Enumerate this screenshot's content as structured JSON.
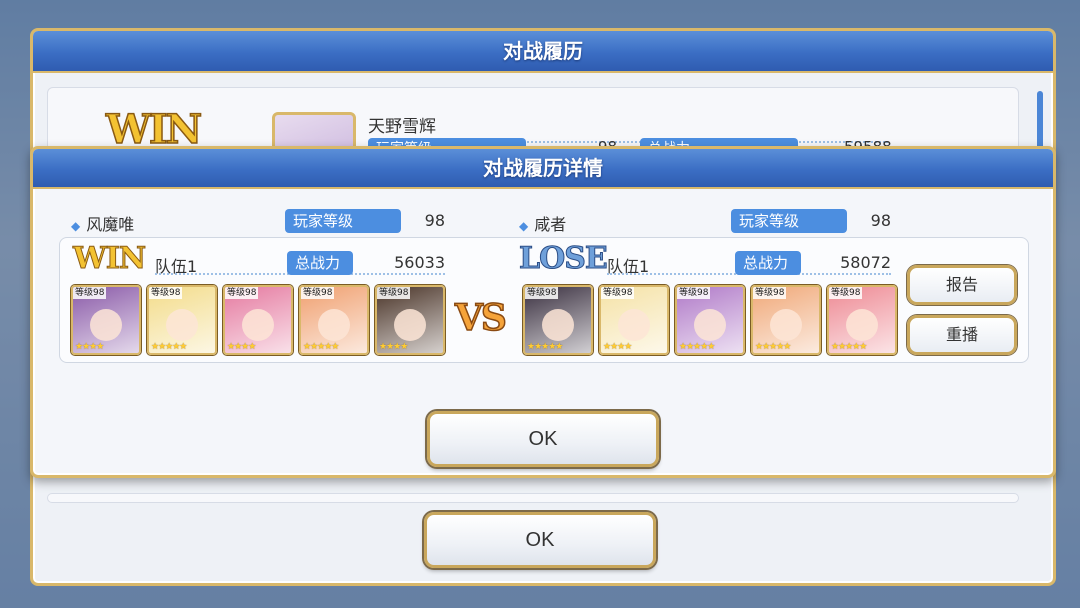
{
  "back_dialog": {
    "title": "对战履历",
    "result": "WIN",
    "player_name": "天野雪辉",
    "level_label": "玩家等级",
    "level_value": "98",
    "power_label": "总战力",
    "power_value": "59588",
    "ok_label": "OK"
  },
  "detail_dialog": {
    "title": "对战履历详情",
    "left": {
      "player_name": "风魔唯",
      "level_label": "玩家等级",
      "level_value": "98",
      "result": "WIN",
      "team_label": "队伍1",
      "power_label": "总战力",
      "power_value": "56033",
      "units": [
        {
          "level": "等级98",
          "stars": "★★★★",
          "color": "#8a5aa8"
        },
        {
          "level": "等级98",
          "stars": "★★★★★",
          "color": "#f3dc8a"
        },
        {
          "level": "等级98",
          "stars": "★★★★",
          "color": "#e57aa0"
        },
        {
          "level": "等级98",
          "stars": "★★★★★",
          "color": "#f0a070"
        },
        {
          "level": "等级98",
          "stars": "★★★★",
          "color": "#4a3428"
        }
      ]
    },
    "vs_label": "VS",
    "right": {
      "player_name": "咸者",
      "level_label": "玩家等级",
      "level_value": "98",
      "result": "LOSE",
      "team_label": "队伍1",
      "power_label": "总战力",
      "power_value": "58072",
      "units": [
        {
          "level": "等级98",
          "stars": "★★★★★",
          "color": "#3a3040"
        },
        {
          "level": "等级98",
          "stars": "★★★★",
          "color": "#f5e2a6"
        },
        {
          "level": "等级98",
          "stars": "★★★★★",
          "color": "#b07ac8"
        },
        {
          "level": "等级98",
          "stars": "★★★★★",
          "color": "#f0a878"
        },
        {
          "level": "等级98",
          "stars": "★★★★★",
          "color": "#ee8a94"
        }
      ]
    },
    "report_label": "报告",
    "replay_label": "重播",
    "ok_label": "OK"
  }
}
